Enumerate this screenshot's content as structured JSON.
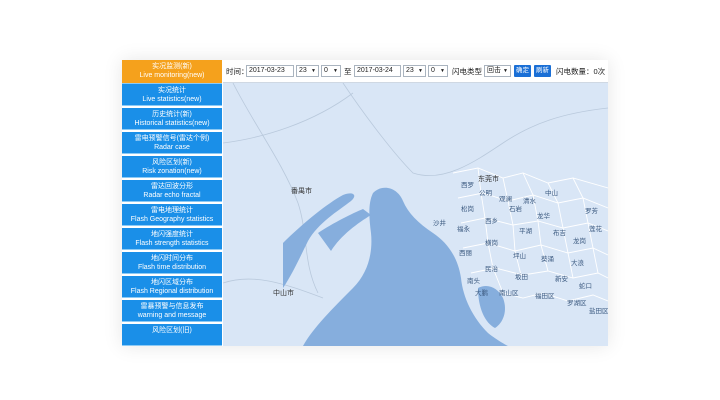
{
  "sidebar": {
    "items": [
      {
        "zh": "实况监测(新)",
        "en": "Live monitoring(new)",
        "active": true
      },
      {
        "zh": "实况统计",
        "en": "Live statistics(new)",
        "active": false
      },
      {
        "zh": "历史统计(新)",
        "en": "Historical statistics(new)",
        "active": false
      },
      {
        "zh": "雷电预警信号(雷达个例)",
        "en": "Radar case",
        "active": false
      },
      {
        "zh": "风险区划(新)",
        "en": "Risk zonation(new)",
        "active": false
      },
      {
        "zh": "雷达回波分形",
        "en": "Radar echo fractal",
        "active": false
      },
      {
        "zh": "雷电地理统计",
        "en": "Flash Geography statistics",
        "active": false
      },
      {
        "zh": "地闪强度统计",
        "en": "Flash strength statistics",
        "active": false
      },
      {
        "zh": "地闪时间分布",
        "en": "Flash time distribution",
        "active": false
      },
      {
        "zh": "地闪区域分布",
        "en": "Flash Regional distribution",
        "active": false
      },
      {
        "zh": "雷暴预警与信息发布",
        "en": "warning and message",
        "active": false
      },
      {
        "zh": "风险区划(旧)",
        "en": "",
        "active": false
      }
    ]
  },
  "toolbar": {
    "time_label": "时间：",
    "start_date": "2017-03-23",
    "start_hour": "23",
    "start_min": "0",
    "to_label": "至",
    "end_date": "2017-03-24",
    "end_hour": "23",
    "end_min": "0",
    "type_label": "闪电类型",
    "type_value": "回击",
    "confirm_label": "确定",
    "refresh_label": "刷新",
    "count_label": "闪电数量：0次"
  },
  "map": {
    "labels": {
      "panyu": "番禺市",
      "dongguan": "东莞市",
      "zhongshan": "中山市",
      "xiangxi": "西罗",
      "gongming": "公明",
      "guanlan": "观澜",
      "songgang": "松岗",
      "shajing": "沙井",
      "fuyong": "福永",
      "xixiang": "西乡",
      "shiyan": "石岩",
      "longhua": "龙华",
      "pinghu": "平湖",
      "buji": "布吉",
      "longgang": "龙岗",
      "henggang": "横岗",
      "pingshan": "坪山",
      "kuichong": "葵涌",
      "nanshan": "南山区",
      "futian": "福田区",
      "luohu": "罗湖区",
      "yantian": "盐田区",
      "xili": "西丽",
      "dalang": "大浪",
      "minzhi": "民治",
      "bantian": "坂田",
      "xinan": "新安",
      "shekou": "蛇口",
      "nantou": "南头",
      "dapeng": "大鹏",
      "qingshui": "清水",
      "zhongshan_river": "中山",
      "luofang": "罗芳",
      "lianhua": "莲花"
    },
    "colors": {
      "land": "#d9e6f6",
      "water": "#86aedd",
      "border": "#b9c9dc"
    }
  }
}
